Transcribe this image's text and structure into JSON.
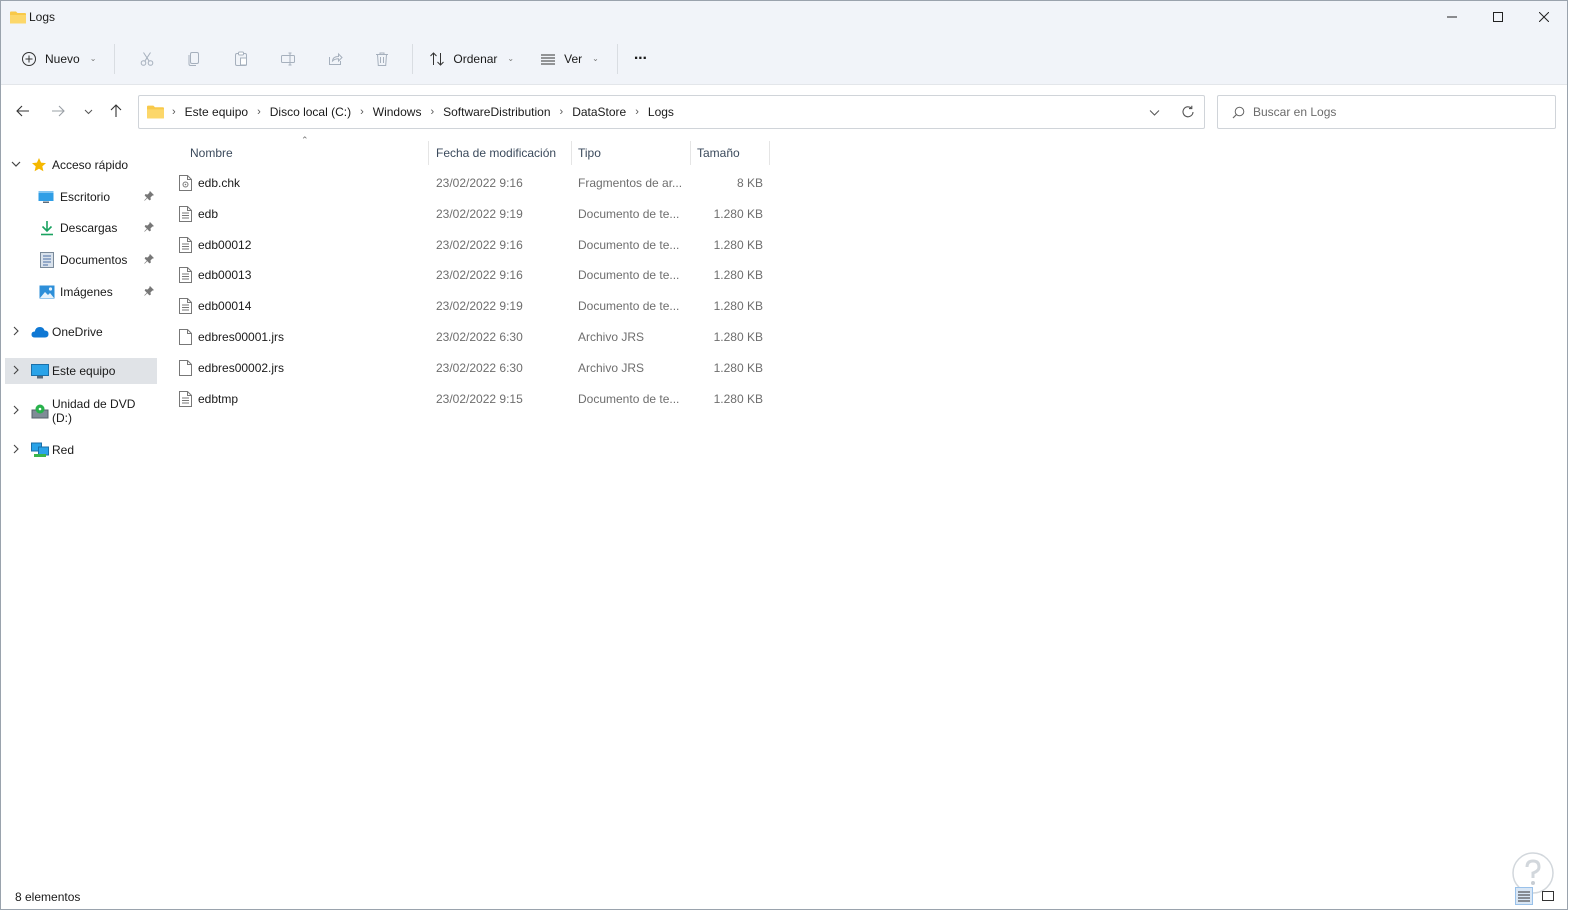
{
  "window": {
    "title": "Logs"
  },
  "toolbar": {
    "new_label": "Nuevo",
    "sort_label": "Ordenar",
    "view_label": "Ver",
    "more_label": "···"
  },
  "address": {
    "crumbs": [
      "Este equipo",
      "Disco local (C:)",
      "Windows",
      "SoftwareDistribution",
      "DataStore",
      "Logs"
    ]
  },
  "search": {
    "placeholder": "Buscar en Logs"
  },
  "sidebar": {
    "items": [
      {
        "label": "Acceso rápido",
        "icon": "star-icon",
        "expander": "expanded"
      },
      {
        "label": "Escritorio",
        "icon": "desktop-icon",
        "pinned": true
      },
      {
        "label": "Descargas",
        "icon": "download-icon",
        "pinned": true
      },
      {
        "label": "Documentos",
        "icon": "documents-icon",
        "pinned": true
      },
      {
        "label": "Imágenes",
        "icon": "pictures-icon",
        "pinned": true
      },
      {
        "label": "OneDrive",
        "icon": "cloud-icon",
        "expander": "collapsed"
      },
      {
        "label": "Este equipo",
        "icon": "computer-icon",
        "expander": "collapsed",
        "selected": true
      },
      {
        "label": "Unidad de DVD (D:)",
        "icon": "dvd-icon",
        "expander": "collapsed"
      },
      {
        "label": "Red",
        "icon": "network-icon",
        "expander": "collapsed"
      }
    ]
  },
  "columns": {
    "name": "Nombre",
    "date": "Fecha de modificación",
    "type": "Tipo",
    "size": "Tamaño"
  },
  "files": [
    {
      "name": "edb.chk",
      "date": "23/02/2022 9:16",
      "type": "Fragmentos de ar...",
      "size": "8 KB",
      "icon": "system-file-icon"
    },
    {
      "name": "edb",
      "date": "23/02/2022 9:19",
      "type": "Documento de te...",
      "size": "1.280 KB",
      "icon": "text-file-icon"
    },
    {
      "name": "edb00012",
      "date": "23/02/2022 9:16",
      "type": "Documento de te...",
      "size": "1.280 KB",
      "icon": "text-file-icon"
    },
    {
      "name": "edb00013",
      "date": "23/02/2022 9:16",
      "type": "Documento de te...",
      "size": "1.280 KB",
      "icon": "text-file-icon"
    },
    {
      "name": "edb00014",
      "date": "23/02/2022 9:19",
      "type": "Documento de te...",
      "size": "1.280 KB",
      "icon": "text-file-icon"
    },
    {
      "name": "edbres00001.jrs",
      "date": "23/02/2022 6:30",
      "type": "Archivo JRS",
      "size": "1.280 KB",
      "icon": "blank-file-icon"
    },
    {
      "name": "edbres00002.jrs",
      "date": "23/02/2022 6:30",
      "type": "Archivo JRS",
      "size": "1.280 KB",
      "icon": "blank-file-icon"
    },
    {
      "name": "edbtmp",
      "date": "23/02/2022 9:15",
      "type": "Documento de te...",
      "size": "1.280 KB",
      "icon": "text-file-icon"
    }
  ],
  "status": {
    "count_text": "8 elementos"
  },
  "colors": {
    "chrome_bg": "#f1f4f9",
    "selected_bg": "#e0e3e7",
    "folder": "#f8c94a",
    "accent": "#0067c0"
  }
}
